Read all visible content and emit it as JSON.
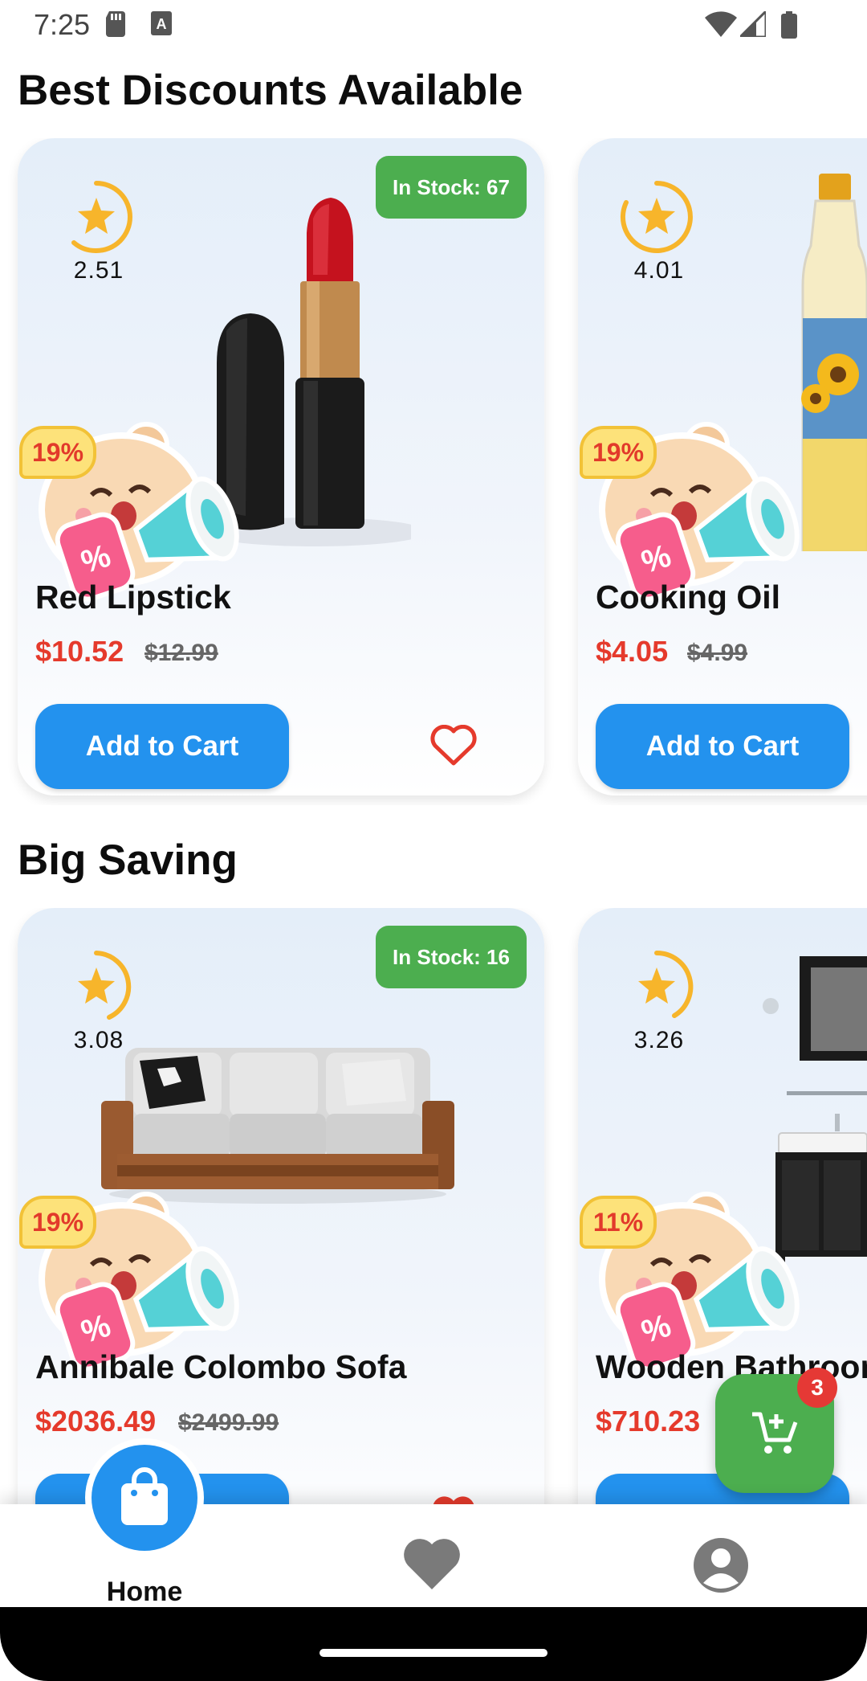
{
  "status_bar": {
    "time": "7:25"
  },
  "sections": [
    {
      "title": "Best Discounts Available",
      "cards": [
        {
          "stock": "In Stock: 67",
          "rating": "2.51",
          "discount": "19%",
          "name": "Red Lipstick",
          "price": "$10.52",
          "old_price": "$12.99",
          "button": "Add to Cart"
        },
        {
          "stock": "",
          "rating": "4.01",
          "discount": "19%",
          "name": "Cooking Oil",
          "price": "$4.05",
          "old_price": "$4.99",
          "button": "Add to Cart"
        }
      ]
    },
    {
      "title": "Big Saving",
      "cards": [
        {
          "stock": "In Stock: 16",
          "rating": "3.08",
          "discount": "19%",
          "name": "Annibale Colombo Sofa",
          "price": "$2036.49",
          "old_price": "$2499.99",
          "button": ""
        },
        {
          "stock": "",
          "rating": "3.26",
          "discount": "11%",
          "name": "Wooden Bathroom",
          "price": "$710.23",
          "old_price": "",
          "button": ""
        }
      ]
    }
  ],
  "cart": {
    "count": "3"
  },
  "nav": {
    "home_label": "Home"
  },
  "colors": {
    "accent": "#2392ee",
    "stock_green": "#4cae4f",
    "price_red": "#e53a2c",
    "star": "#f7b52b"
  }
}
